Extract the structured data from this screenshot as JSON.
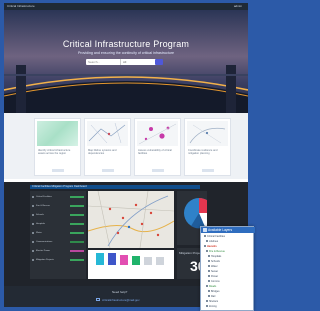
{
  "topbar": {
    "brand": "Critical Infrastructure",
    "user": "admin"
  },
  "hero": {
    "title": "Critical Infrastructure Program",
    "subtitle": "Providing and ensuring the continuity of critical infrastructure",
    "search_placeholder": "Search...",
    "select_value": "All",
    "go_icon": "search-icon"
  },
  "cards": [
    {
      "text": "Identify critical infrastructure assets across the region"
    },
    {
      "text": "Map lifeline systems and dependencies"
    },
    {
      "text": "Assess vulnerability of critical facilities"
    },
    {
      "text": "Coordinate resilience and mitigation planning"
    }
  ],
  "dashboard": {
    "title": "Critical Facilities Mitigation Program Dashboard",
    "rows": [
      "Critical Facilities",
      "Fire & Rescue",
      "Schools",
      "Hospitals",
      "Water",
      "Communications",
      "Electric Power",
      "Mitigation Projects"
    ],
    "mitigation_label": "Mitigation Projects",
    "mitigation_value": "30"
  },
  "footer": {
    "question": "Need help?",
    "email": "criticalinfrastructure@mail.gov"
  },
  "layers_panel": {
    "title": "Available Layers",
    "items": [
      "Critical Facilities",
      "Lifelines",
      "Hazards",
      "Fire & Rescue",
      "Hospitals",
      "Schools",
      "Water",
      "Sewer",
      "Power",
      "Comms",
      "Roads",
      "Bridges",
      "Rail",
      "Shelters",
      "Zoning"
    ]
  },
  "colors": {
    "accent": "#2f6dbf",
    "dashboard_bg": "#20242b",
    "hero_dark": "#2b3556"
  }
}
